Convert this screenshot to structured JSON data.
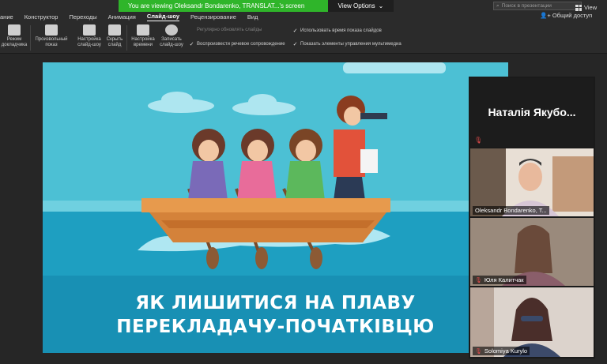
{
  "topbar": {
    "menu": [
      {
        "label": "ание",
        "active": false
      },
      {
        "label": "Конструктор",
        "active": false
      },
      {
        "label": "Переходы",
        "active": false
      },
      {
        "label": "Анимация",
        "active": false
      },
      {
        "label": "Слайд-шоу",
        "active": true
      },
      {
        "label": "Рецензирование",
        "active": false
      },
      {
        "label": "Вид",
        "active": false
      }
    ],
    "viewing_text": "You are viewing Oleksandr Bondarenko, TRANSLAT...'s screen",
    "view_options_label": "View Options",
    "search_placeholder": "Поиск в презентации",
    "share_label": "Общий доступ",
    "view_label": "View",
    "accent_color": "#2fb52a"
  },
  "ribbon": {
    "buttons": [
      {
        "label": "Режим\nдокладчика"
      },
      {
        "label": "Произвольный\nпоказ"
      },
      {
        "label": "Настройка\nслайд-шоу"
      },
      {
        "label": "Скрыть\nслайд"
      },
      {
        "label": "Настройка\nвремени"
      },
      {
        "label": "Записать\nслайд-шоу"
      }
    ],
    "checks": [
      {
        "label": "Регулярно обновлять слайды",
        "checked": false
      },
      {
        "label": "Воспроизвести речевое сопровождение",
        "checked": true
      },
      {
        "label": "Использовать время показа слайдов",
        "checked": true
      },
      {
        "label": "Показать элементы управления мультимедиа",
        "checked": true
      }
    ]
  },
  "slide": {
    "title_line1": "ЯК ЛИШИТИСЯ НА ПЛАВУ",
    "title_line2": "ПЕРЕКЛАДАЧУ-ПОЧАТКІВЦЮ",
    "sky_color": "#4cc0d4",
    "sea_color": "#1a9ec0"
  },
  "participants": {
    "featured_name": "Наталія Якубо...",
    "tiles": [
      {
        "name": "Oleksandr Bondarenko, T...",
        "muted": false
      },
      {
        "name": "Юля Калитчак",
        "muted": true
      },
      {
        "name": "Solomiya Kurylo",
        "muted": true
      }
    ]
  }
}
